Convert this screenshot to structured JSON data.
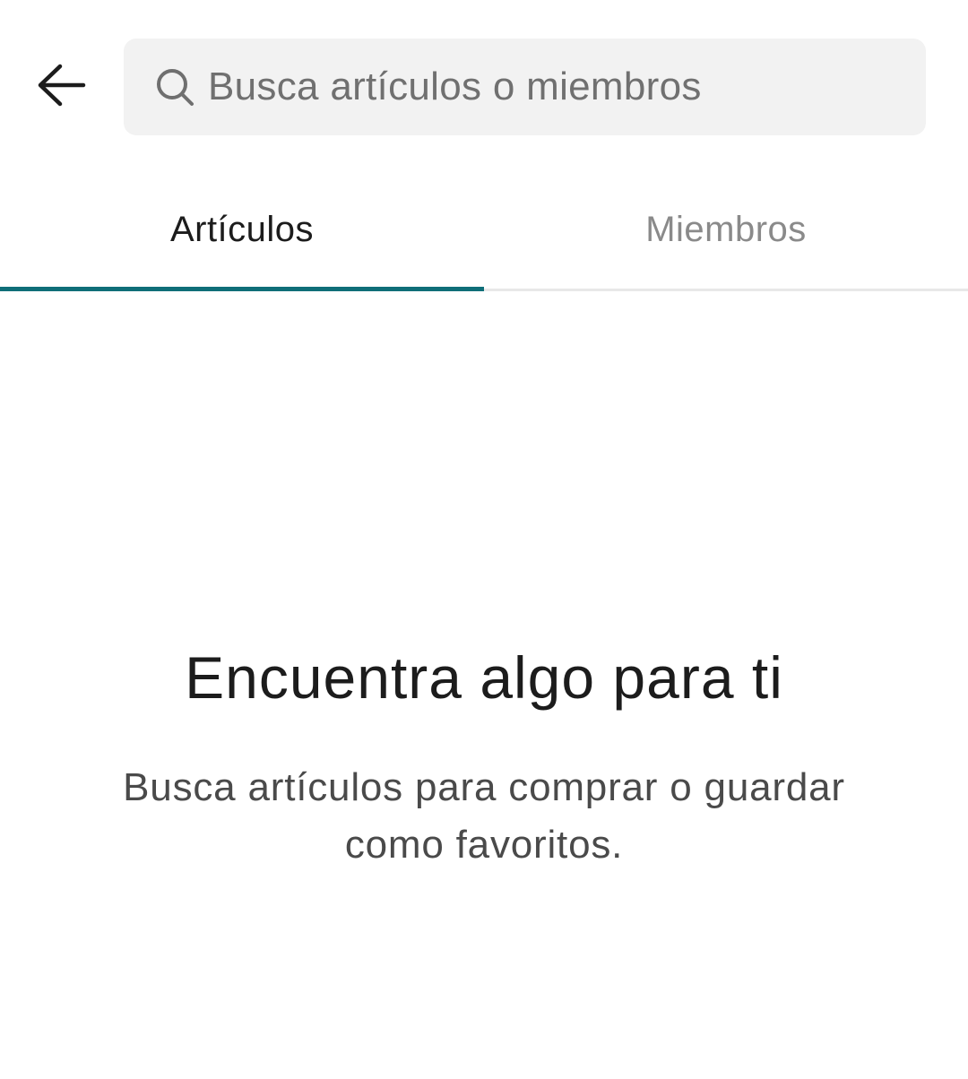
{
  "header": {
    "back_icon": "arrow-left-icon",
    "search": {
      "icon": "search-icon",
      "placeholder": "Busca artículos o miembros",
      "value": ""
    }
  },
  "tabs": [
    {
      "label": "Artículos",
      "active": true
    },
    {
      "label": "Miembros",
      "active": false
    }
  ],
  "empty_state": {
    "title": "Encuentra algo para ti",
    "description": "Busca artículos para comprar o guardar como favoritos."
  },
  "colors": {
    "accent": "#0f6e78",
    "search_bg": "#f2f2f2",
    "text_primary": "#1c1c1c",
    "text_muted": "#8a8a8a"
  }
}
